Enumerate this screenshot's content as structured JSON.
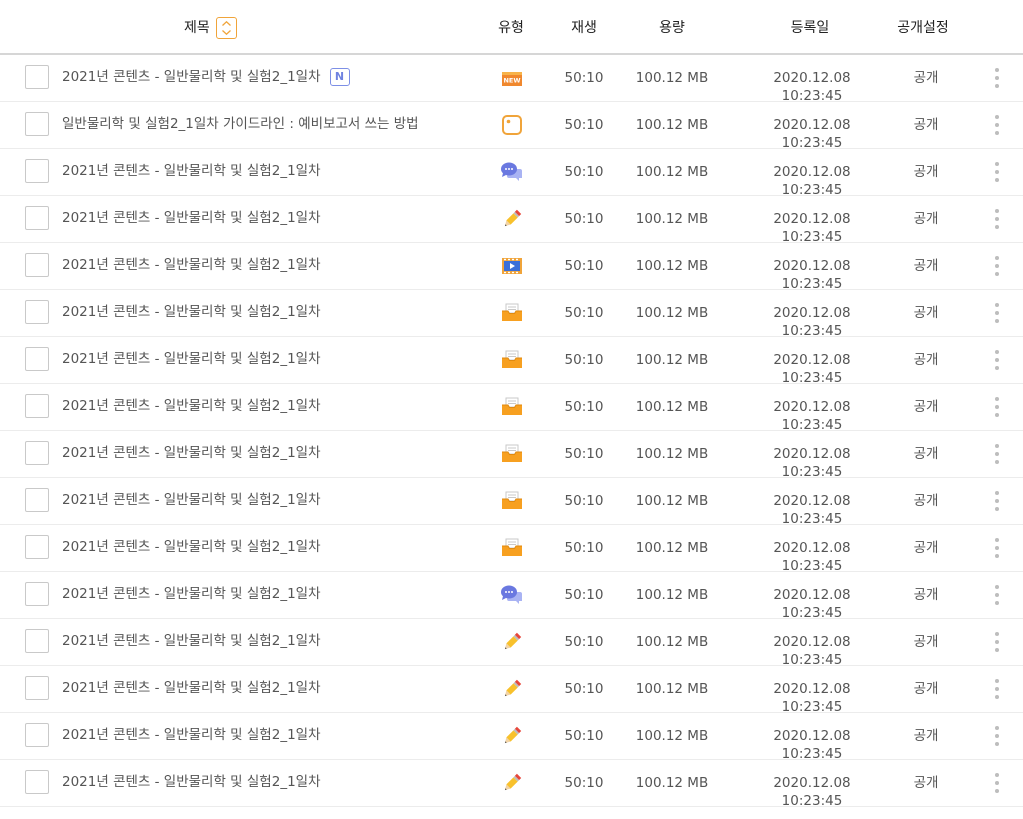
{
  "header": {
    "title_label": "제목",
    "type_label": "유형",
    "play_label": "재생",
    "size_label": "용량",
    "date_label": "등록일",
    "public_label": "공개설정"
  },
  "colors": {
    "accent_orange": "#f0a43a",
    "badge_blue": "#6f82e0",
    "chat_blue": "#6a78e0",
    "pencil_yellow": "#f8c12c"
  },
  "rows": [
    {
      "title": "2021년 콘텐츠 - 일반물리학 및 실험2_1일차",
      "badge": "N",
      "type": "new-icon",
      "play": "50:10",
      "size": "100.12 MB",
      "date": "2020.12.08 10:23:45",
      "public": "공개"
    },
    {
      "title": "일반물리학 및 실험2_1일차 가이드라인 : 예비보고서 쓰는 방법",
      "badge": "",
      "type": "note-icon",
      "play": "50:10",
      "size": "100.12 MB",
      "date": "2020.12.08 10:23:45",
      "public": "공개"
    },
    {
      "title": "2021년 콘텐츠 - 일반물리학 및 실험2_1일차",
      "badge": "",
      "type": "chat-icon",
      "play": "50:10",
      "size": "100.12 MB",
      "date": "2020.12.08 10:23:45",
      "public": "공개"
    },
    {
      "title": "2021년 콘텐츠 - 일반물리학 및 실험2_1일차",
      "badge": "",
      "type": "pencil-icon",
      "play": "50:10",
      "size": "100.12 MB",
      "date": "2020.12.08 10:23:45",
      "public": "공개"
    },
    {
      "title": "2021년 콘텐츠 - 일반물리학 및 실험2_1일차",
      "badge": "",
      "type": "video-icon",
      "play": "50:10",
      "size": "100.12 MB",
      "date": "2020.12.08 10:23:45",
      "public": "공개"
    },
    {
      "title": "2021년 콘텐츠 - 일반물리학 및 실험2_1일차",
      "badge": "",
      "type": "inbox-icon",
      "play": "50:10",
      "size": "100.12 MB",
      "date": "2020.12.08 10:23:45",
      "public": "공개"
    },
    {
      "title": "2021년 콘텐츠 - 일반물리학 및 실험2_1일차",
      "badge": "",
      "type": "inbox-icon",
      "play": "50:10",
      "size": "100.12 MB",
      "date": "2020.12.08 10:23:45",
      "public": "공개"
    },
    {
      "title": "2021년 콘텐츠 - 일반물리학 및 실험2_1일차",
      "badge": "",
      "type": "inbox-icon",
      "play": "50:10",
      "size": "100.12 MB",
      "date": "2020.12.08 10:23:45",
      "public": "공개"
    },
    {
      "title": "2021년 콘텐츠 - 일반물리학 및 실험2_1일차",
      "badge": "",
      "type": "inbox-icon",
      "play": "50:10",
      "size": "100.12 MB",
      "date": "2020.12.08 10:23:45",
      "public": "공개"
    },
    {
      "title": "2021년 콘텐츠 - 일반물리학 및 실험2_1일차",
      "badge": "",
      "type": "inbox-icon",
      "play": "50:10",
      "size": "100.12 MB",
      "date": "2020.12.08 10:23:45",
      "public": "공개"
    },
    {
      "title": "2021년 콘텐츠 - 일반물리학 및 실험2_1일차",
      "badge": "",
      "type": "inbox-icon",
      "play": "50:10",
      "size": "100.12 MB",
      "date": "2020.12.08 10:23:45",
      "public": "공개"
    },
    {
      "title": "2021년 콘텐츠 - 일반물리학 및 실험2_1일차",
      "badge": "",
      "type": "chat-icon",
      "play": "50:10",
      "size": "100.12 MB",
      "date": "2020.12.08 10:23:45",
      "public": "공개"
    },
    {
      "title": "2021년 콘텐츠 - 일반물리학 및 실험2_1일차",
      "badge": "",
      "type": "pencil-icon",
      "play": "50:10",
      "size": "100.12 MB",
      "date": "2020.12.08 10:23:45",
      "public": "공개"
    },
    {
      "title": "2021년 콘텐츠 - 일반물리학 및 실험2_1일차",
      "badge": "",
      "type": "pencil-icon",
      "play": "50:10",
      "size": "100.12 MB",
      "date": "2020.12.08 10:23:45",
      "public": "공개"
    },
    {
      "title": "2021년 콘텐츠 - 일반물리학 및 실험2_1일차",
      "badge": "",
      "type": "pencil-icon",
      "play": "50:10",
      "size": "100.12 MB",
      "date": "2020.12.08 10:23:45",
      "public": "공개"
    },
    {
      "title": "2021년 콘텐츠 - 일반물리학 및 실험2_1일차",
      "badge": "",
      "type": "pencil-icon",
      "play": "50:10",
      "size": "100.12 MB",
      "date": "2020.12.08 10:23:45",
      "public": "공개"
    }
  ]
}
